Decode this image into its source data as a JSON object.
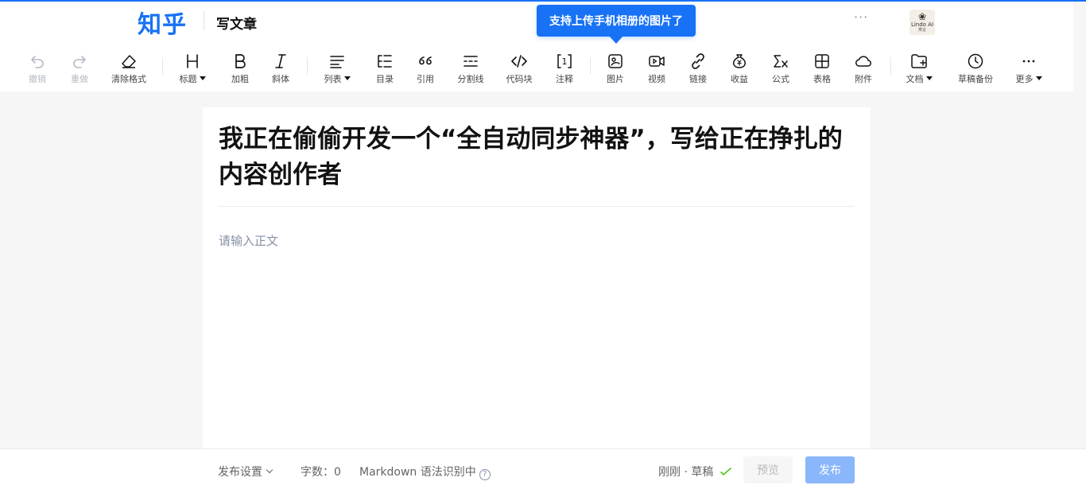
{
  "header": {
    "logo": "知乎",
    "title": "写文章",
    "more": "···",
    "avatar_text": "Lindo AI",
    "avatar_subtext": "寓言"
  },
  "tooltip": {
    "text": "支持上传手机相册的图片了"
  },
  "toolbar": {
    "undo": "撤销",
    "redo": "重做",
    "clear_format": "清除格式",
    "heading": "标题",
    "bold": "加粗",
    "italic": "斜体",
    "list": "列表",
    "toc": "目录",
    "quote": "引用",
    "divider": "分割线",
    "code_block": "代码块",
    "footnote": "注释",
    "image": "图片",
    "video": "视频",
    "link": "链接",
    "income": "收益",
    "formula": "公式",
    "table": "表格",
    "attachment": "附件",
    "document": "文档",
    "draft_backup": "草稿备份",
    "more": "更多"
  },
  "editor": {
    "title": "我正在偷偷开发一个“全自动同步神器”，写给正在挣扎的内容创作者",
    "body_placeholder": "请输入正文"
  },
  "footer": {
    "publish_settings": "发布设置",
    "word_count": "字数：0",
    "markdown": "Markdown 语法识别中",
    "status": "刚刚 · 草稿",
    "preview": "预览",
    "publish": "发布"
  },
  "colors": {
    "brand": "#1772f6",
    "publish_disabled": "#8ab6fb",
    "saved_check": "#53c41a"
  }
}
